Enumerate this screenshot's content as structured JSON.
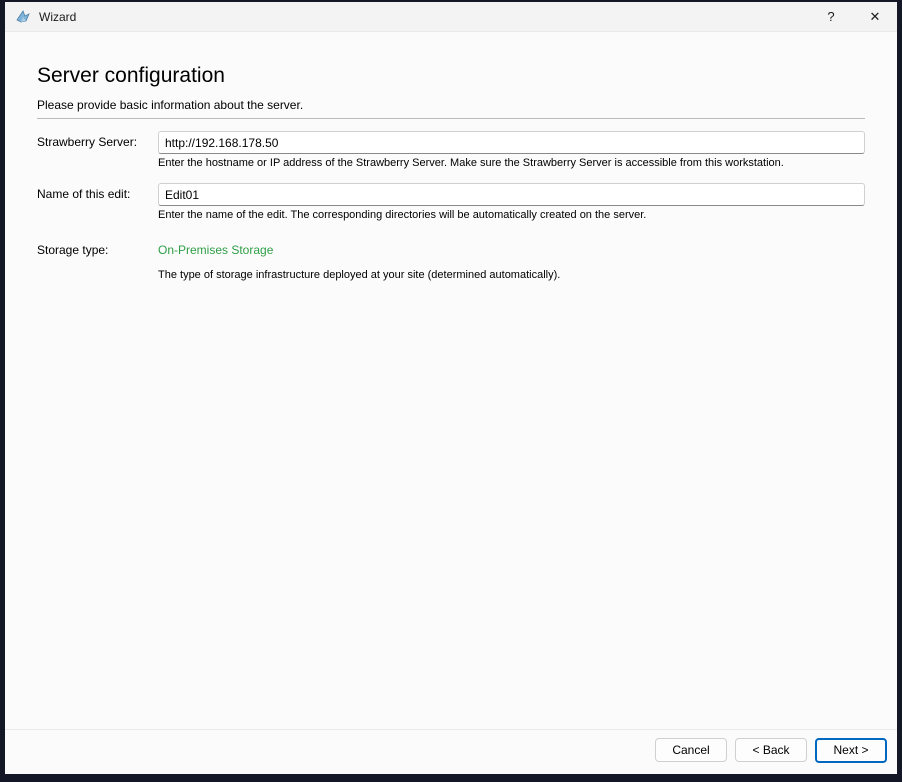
{
  "window": {
    "title": "Wizard",
    "help_label": "?",
    "close_label": "✕"
  },
  "page": {
    "title": "Server configuration",
    "subtitle": "Please provide basic information about the server."
  },
  "form": {
    "fields": [
      {
        "label": "Strawberry Server:",
        "value": "http://192.168.178.50",
        "help": "Enter the hostname or IP address of the Strawberry Server. Make sure the Strawberry Server is accessible from this workstation."
      },
      {
        "label": "Name of this edit:",
        "value": "Edit01",
        "help": "Enter the name of the edit. The corresponding directories will be automatically created on the server."
      },
      {
        "label": "Storage type:",
        "value": "On-Premises Storage",
        "help": "The type of storage infrastructure deployed at your site (determined automatically)."
      }
    ]
  },
  "footer": {
    "cancel_label": "Cancel",
    "back_label": "< Back",
    "next_label": "Next >"
  },
  "colors": {
    "storage_value_green": "#2e9e46",
    "next_button_border": "#0067c0",
    "window_border": "#131726"
  }
}
